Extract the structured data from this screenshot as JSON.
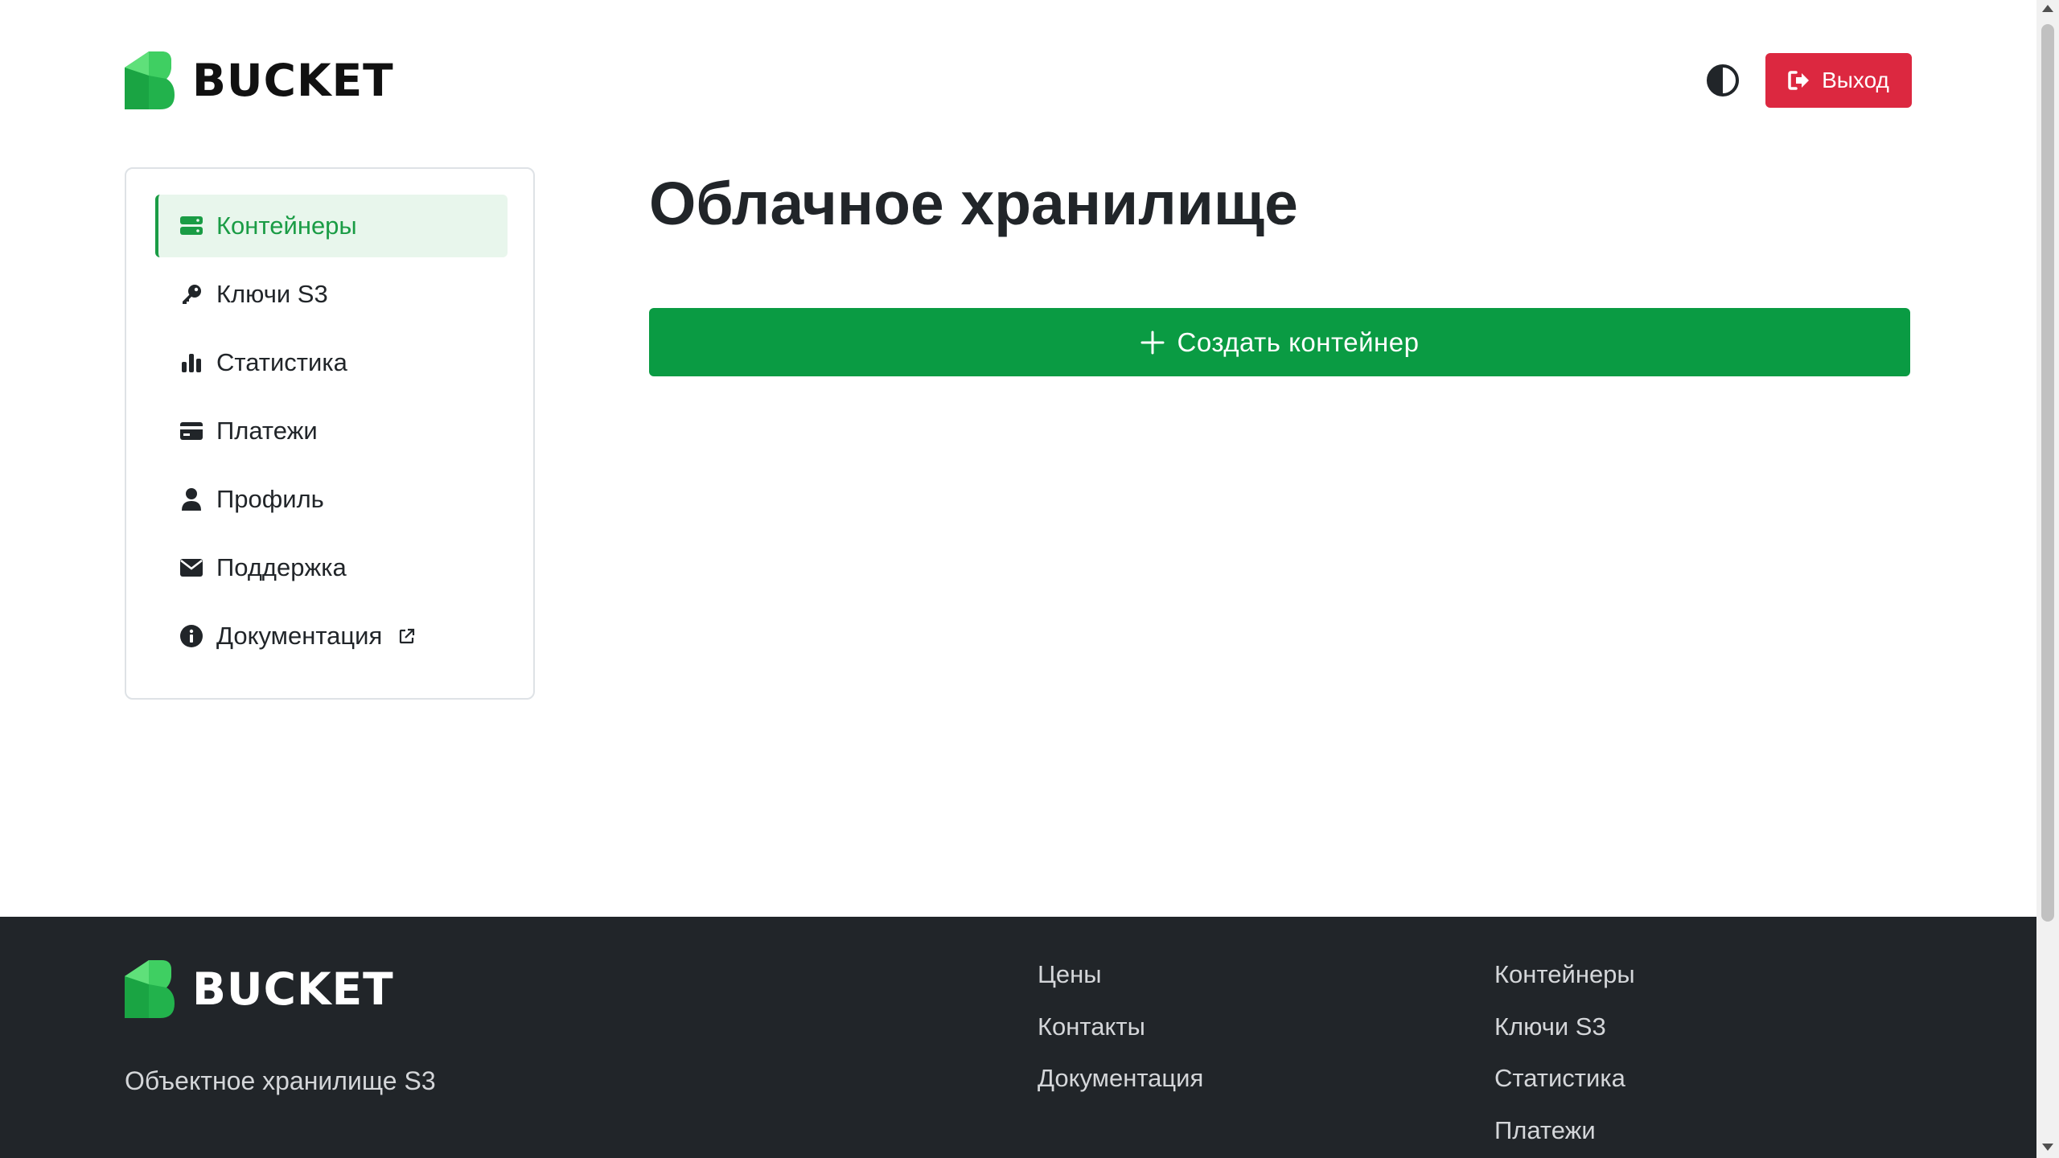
{
  "brand": {
    "name": "BUCKET",
    "color": "#1db954"
  },
  "header": {
    "theme_toggle_icon": "contrast-icon",
    "logout_label": "Выход"
  },
  "sidebar": {
    "items": [
      {
        "label": "Контейнеры",
        "icon": "server-icon",
        "active": true
      },
      {
        "label": "Ключи S3",
        "icon": "key-icon",
        "active": false
      },
      {
        "label": "Статистика",
        "icon": "bar-chart-icon",
        "active": false
      },
      {
        "label": "Платежи",
        "icon": "credit-card-icon",
        "active": false
      },
      {
        "label": "Профиль",
        "icon": "user-icon",
        "active": false
      },
      {
        "label": "Поддержка",
        "icon": "envelope-icon",
        "active": false
      },
      {
        "label": "Документация",
        "icon": "info-icon",
        "active": false,
        "external": true
      }
    ]
  },
  "main": {
    "title": "Облачное хранилище",
    "create_button_label": "Создать контейнер"
  },
  "footer": {
    "brand": "BUCKET",
    "tagline": "Объектное хранилище S3",
    "col1": [
      "Цены",
      "Контакты",
      "Документация"
    ],
    "col2": [
      "Контейнеры",
      "Ключи S3",
      "Статистика",
      "Платежи"
    ]
  },
  "colors": {
    "accent": "#0a9b43",
    "danger": "#dc2840",
    "active_bg": "#e8f6ec",
    "footer_bg": "#212529"
  }
}
